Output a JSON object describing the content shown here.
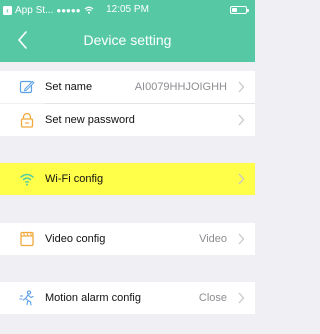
{
  "status_bar": {
    "back_app": "App St...",
    "signal": "●●●●●",
    "time": "12:05 PM",
    "battery_level": 0.35
  },
  "nav": {
    "title": "Device setting",
    "back_icon": "chevron-left-icon"
  },
  "rows": [
    {
      "id": "set-name",
      "icon": "edit-icon",
      "label": "Set name",
      "value": "AI0079HHJOIGHH"
    },
    {
      "id": "set-password",
      "icon": "lock-icon",
      "label": "Set new password",
      "value": ""
    },
    {
      "id": "wifi-config",
      "icon": "wifi-icon",
      "label": "Wi-Fi config",
      "value": ""
    },
    {
      "id": "video-config",
      "icon": "video-icon",
      "label": "Video config",
      "value": "Video"
    },
    {
      "id": "motion-alarm",
      "icon": "motion-icon",
      "label": "Motion alarm config",
      "value": "Close"
    }
  ],
  "colors": {
    "accent": "#56c9a4",
    "icon_blue": "#5aa0e6",
    "icon_orange": "#f2a93b",
    "highlight": "#ffff4a",
    "background": "#efeff4"
  }
}
